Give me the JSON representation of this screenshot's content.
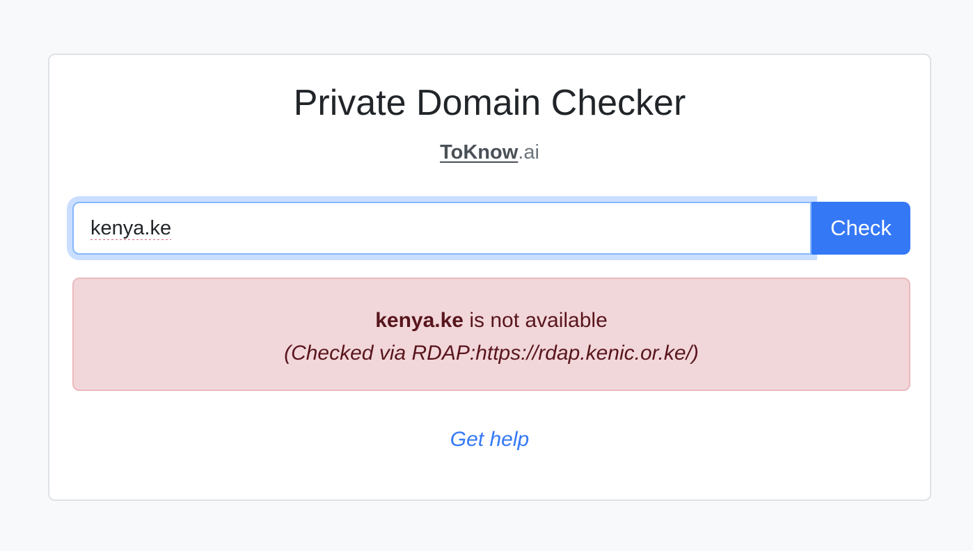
{
  "header": {
    "title": "Private Domain Checker",
    "brand_link": "ToKnow",
    "brand_suffix": ".ai"
  },
  "search": {
    "value": "kenya.ke",
    "button_label": "Check"
  },
  "result": {
    "status": "unavailable",
    "domain": "kenya.ke",
    "message": " is not available",
    "source": "(Checked via RDAP:https://rdap.kenic.or.ke/)"
  },
  "footer": {
    "help_link": "Get help"
  },
  "colors": {
    "primary": "#3478f6",
    "danger_bg": "#f2d7da",
    "danger_text": "#58151c",
    "page_bg": "#f8f9fa"
  }
}
